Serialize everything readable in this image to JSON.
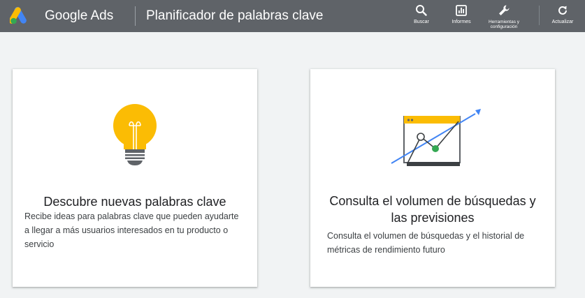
{
  "header": {
    "brand": "Google Ads",
    "page_title": "Planificador de palabras clave",
    "tools": [
      {
        "icon": "search-icon",
        "label": "Buscar"
      },
      {
        "icon": "reports-icon",
        "label": "Informes"
      },
      {
        "icon": "wrench-icon",
        "label": "Herramientas y configuración"
      },
      {
        "icon": "refresh-icon",
        "label": "Actualizar"
      }
    ]
  },
  "cards": [
    {
      "icon": "lightbulb-icon",
      "title": "Descubre nuevas palabras clave",
      "description": "Recibe ideas para palabras clave que pueden ayudarte a llegar a más usuarios interesados en tu producto o servicio"
    },
    {
      "icon": "trend-chart-icon",
      "title": "Consulta el volumen de búsquedas y las previsiones",
      "description": "Consulta el volumen de búsquedas y el historial de métricas de rendimiento futuro"
    }
  ],
  "colors": {
    "topbar": "#5f6368",
    "background": "#f1f3f4",
    "google_yellow": "#fbbc04",
    "google_blue": "#4285f4",
    "google_green": "#34a853"
  }
}
